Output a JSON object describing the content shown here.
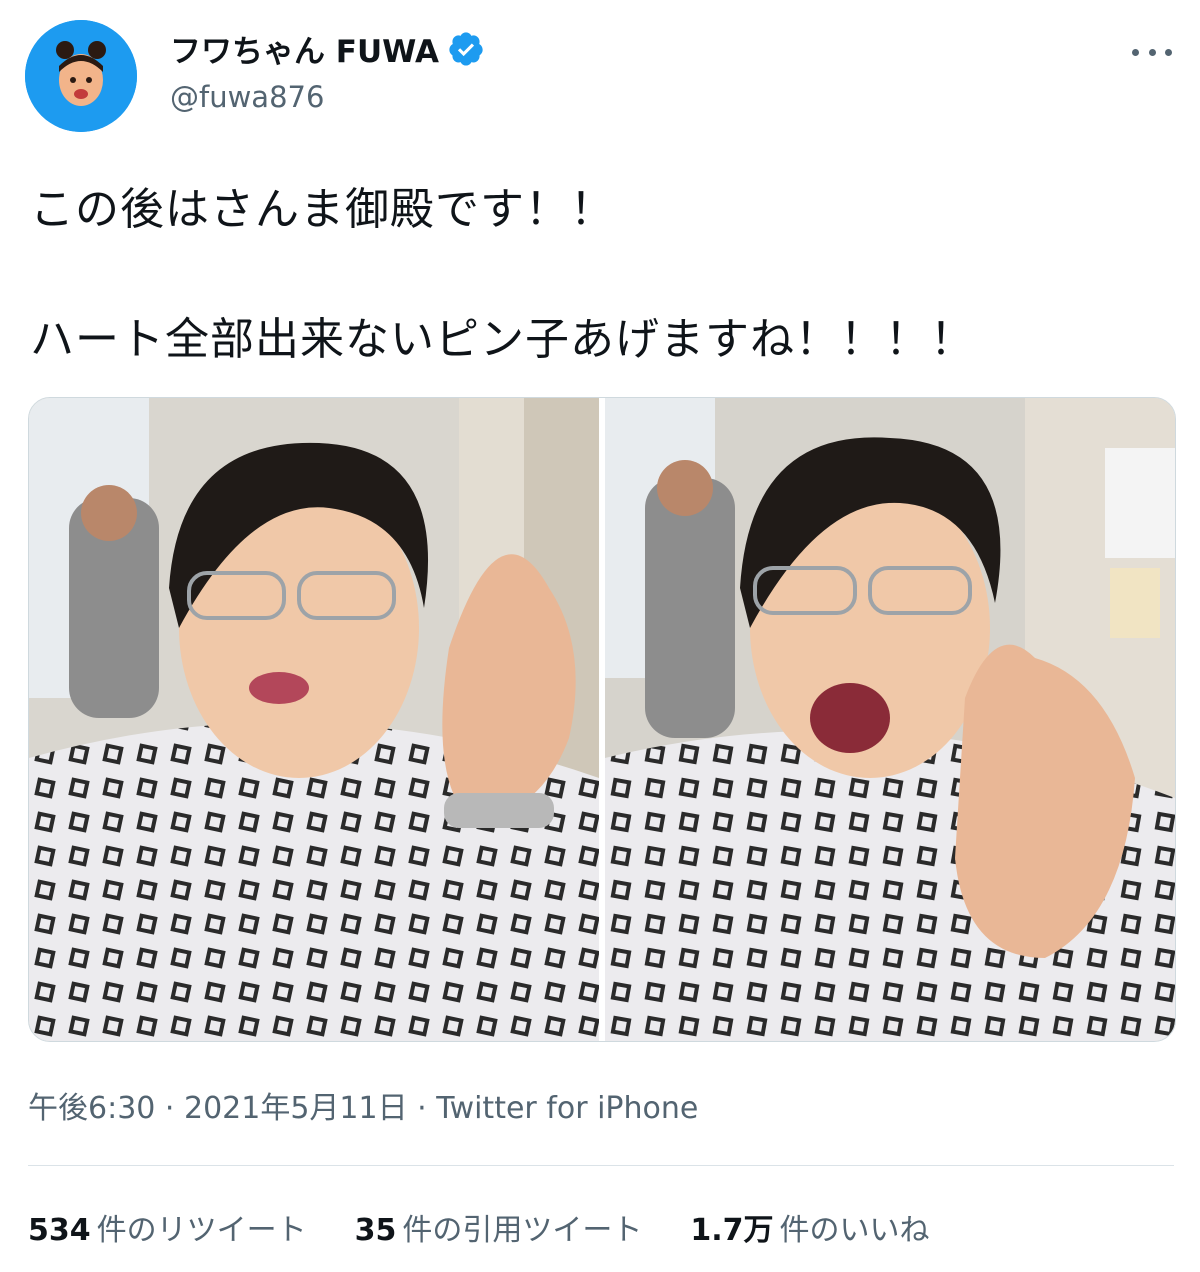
{
  "user": {
    "display_name": "フワちゃん FUWA",
    "handle": "@fuwa876",
    "verified": true,
    "avatar_color": "#1d9bf0"
  },
  "tweet": {
    "line1": "この後はさんま御殿です！！",
    "line2": "ハート全部出来ないピン子あげますね！！！！",
    "timestamp": "午後6:30 · 2021年5月11日",
    "source_separator": " · ",
    "source": "Twitter for iPhone"
  },
  "stats": [
    {
      "count": "534",
      "label": "件のリツイート"
    },
    {
      "count": "35",
      "label": "件の引用ツイート"
    },
    {
      "count": "1.7万",
      "label": "件のいいね"
    }
  ],
  "colors": {
    "secondary_text": "#536471",
    "primary_text": "#0f1419",
    "verified_blue": "#1d9bf0"
  },
  "icons": {
    "verified": "verified-badge-icon",
    "more": "more-dots-icon"
  }
}
